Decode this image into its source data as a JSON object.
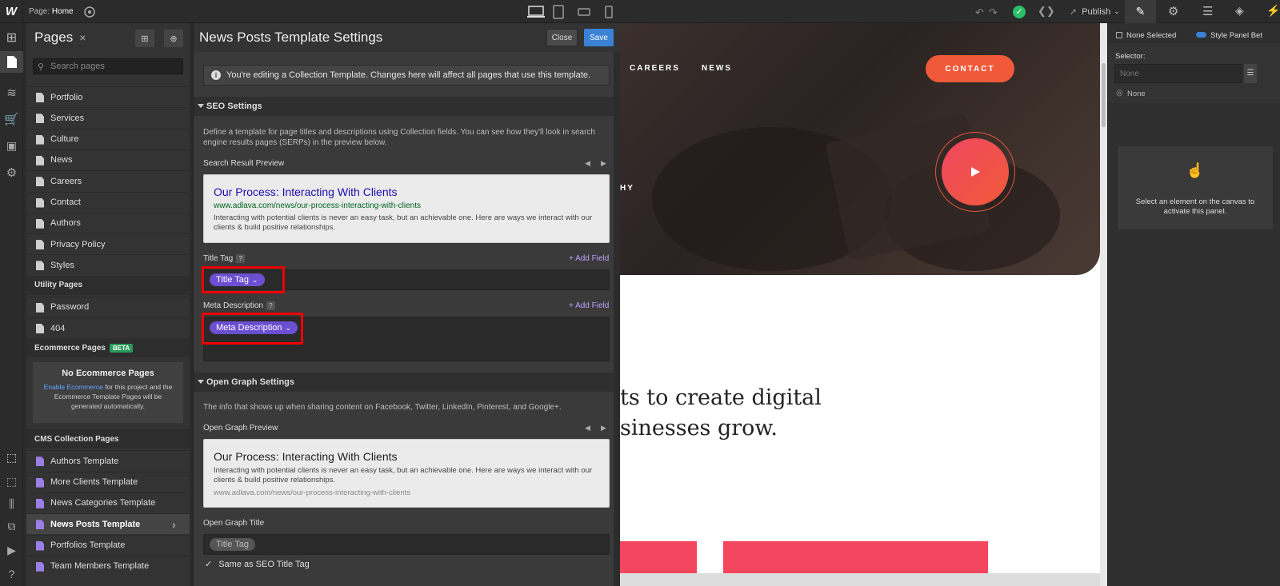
{
  "topbar": {
    "page_label": "Page:",
    "page_name": "Home",
    "publish_label": "Publish"
  },
  "pages_panel": {
    "title": "Pages",
    "search_placeholder": "Search pages",
    "static_pages": [
      "Portfolio",
      "Services",
      "Culture",
      "News",
      "Careers",
      "Contact",
      "Authors",
      "Privacy Policy",
      "Styles"
    ],
    "utility_header": "Utility Pages",
    "utility_pages": [
      "Password",
      "404"
    ],
    "ecommerce_header": "Ecommerce Pages",
    "ecommerce_badge": "BETA",
    "no_ecom_title": "No Ecommerce Pages",
    "no_ecom_link": "Enable Ecommerce",
    "no_ecom_text": "for this project and the Ecommerce Template Pages will be generated automatically.",
    "cms_header": "CMS Collection Pages",
    "cms_pages": [
      "Authors Template",
      "More Clients Template",
      "News Categories Template",
      "News Posts Template",
      "Portfolios Template",
      "Team Members Template"
    ],
    "active_cms": "News Posts Template"
  },
  "template_settings": {
    "title": "News Posts Template Settings",
    "close_label": "Close",
    "save_label": "Save",
    "notice": "You're editing a Collection Template. Changes here will affect all pages that use this template.",
    "seo": {
      "header": "SEO Settings",
      "description": "Define a template for page titles and descriptions using Collection fields. You can see how they'll look in search engine results pages (SERPs) in the preview below.",
      "preview_label": "Search Result Preview",
      "preview_title": "Our Process: Interacting With Clients",
      "preview_url": "www.adlava.com/news/our-process-interacting-with-clients",
      "preview_desc": "Interacting with potential clients is never an easy task, but an achievable one. Here are ways we interact with our clients & build positive relationships.",
      "title_tag_label": "Title Tag",
      "title_tag_pill": "Title Tag",
      "meta_label": "Meta Description",
      "meta_pill": "Meta Description",
      "add_field": "+ Add Field",
      "help": "?"
    },
    "og": {
      "header": "Open Graph Settings",
      "description": "The info that shows up when sharing content on Facebook, Twitter, LinkedIn, Pinterest, and Google+.",
      "preview_label": "Open Graph Preview",
      "preview_title": "Our Process: Interacting With Clients",
      "preview_desc": "Interacting with potential clients is never an easy task, but an achievable one. Here are ways we interact with our clients & build positive relationships.",
      "preview_url": "www.adlava.com/news/our-process-interacting-with-clients",
      "title_label": "Open Graph Title",
      "title_pill": "Title Tag",
      "same_as_label": "Same as SEO Title Tag"
    }
  },
  "canvas": {
    "nav": [
      "CAREERS",
      "NEWS"
    ],
    "contact_label": "CONTACT",
    "partial_text": "HY",
    "headline_line1": "ts to create digital",
    "headline_line2": "sinesses grow."
  },
  "style_panel": {
    "none_selected": "None Selected",
    "style_panel_toggle": "Style Panel Bet",
    "selector_label": "Selector:",
    "selector_placeholder": "None",
    "state_label": "None",
    "empty_text": "Select an element on the canvas to activate this panel."
  },
  "colors": {
    "accent_purple": "#6c4fd1",
    "save_blue": "#3b82d6",
    "contact_orange": "#f05a3a",
    "play_red": "#f0475f",
    "highlight_red": "#e00000"
  }
}
